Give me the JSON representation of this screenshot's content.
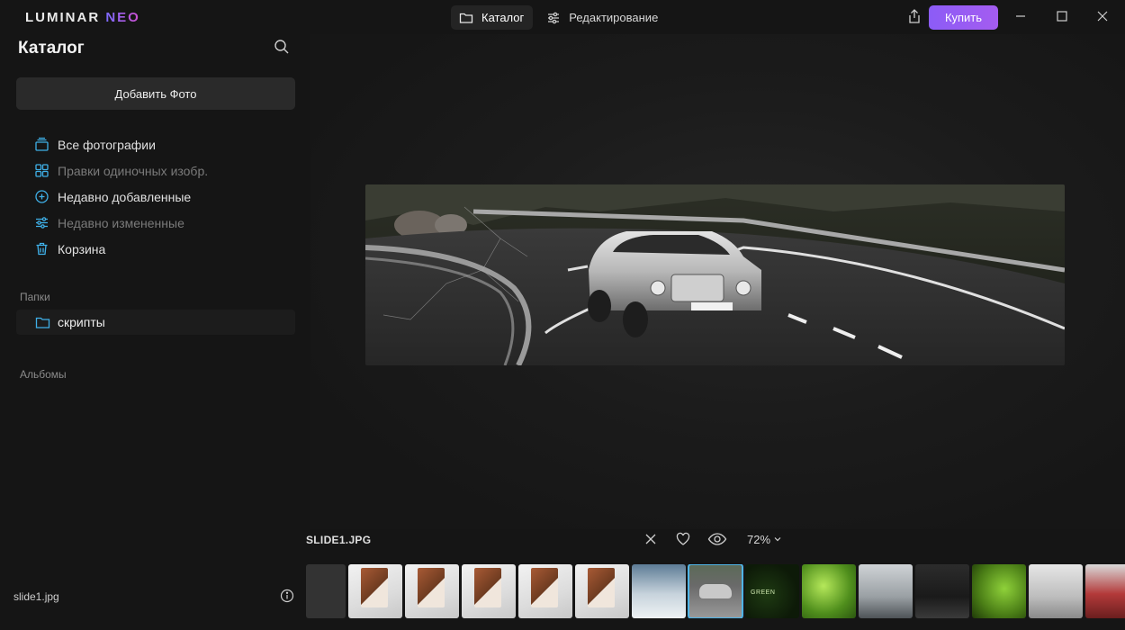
{
  "app": {
    "logo_main": "LUMINAR",
    "logo_accent": "NEO"
  },
  "modes": [
    {
      "label": "Каталог",
      "icon": "folder-icon",
      "active": true
    },
    {
      "label": "Редактирование",
      "icon": "sliders-icon",
      "active": false
    }
  ],
  "titlebar": {
    "buy_label": "Купить",
    "buy_color": "#8c5cf6"
  },
  "sidebar": {
    "title": "Каталог",
    "add_photo_label": "Добавить Фото",
    "nav": [
      {
        "label": "Все фотографии",
        "icon": "stack-icon",
        "dim": false
      },
      {
        "label": "Правки одиночных изобр.",
        "icon": "grid-icon",
        "dim": true
      },
      {
        "label": "Недавно добавленные",
        "icon": "plus-circle-icon",
        "dim": false
      },
      {
        "label": "Недавно измененные",
        "icon": "sliders-icon",
        "dim": true
      },
      {
        "label": "Корзина",
        "icon": "trash-icon",
        "dim": false
      }
    ],
    "folders_label": "Папки",
    "folders": [
      {
        "label": "скрипты",
        "icon": "folder-icon"
      }
    ],
    "albums_label": "Альбомы",
    "current_file": "slide1.jpg"
  },
  "viewer": {
    "filename": "SLIDE1.JPG",
    "zoom": "72%",
    "accent_color": "#4fb4e6"
  },
  "filmstrip": {
    "thumbs": [
      {
        "kind": "t-first",
        "selected": false,
        "text": ""
      },
      {
        "kind": "t-box",
        "selected": false,
        "text": ""
      },
      {
        "kind": "t-box",
        "selected": false,
        "text": ""
      },
      {
        "kind": "t-box",
        "selected": false,
        "text": ""
      },
      {
        "kind": "t-box",
        "selected": false,
        "text": ""
      },
      {
        "kind": "t-box",
        "selected": false,
        "text": ""
      },
      {
        "kind": "t-snow",
        "selected": false,
        "text": ""
      },
      {
        "kind": "t-car",
        "selected": true,
        "text": ""
      },
      {
        "kind": "t-green1",
        "selected": false,
        "text": "GREEN"
      },
      {
        "kind": "t-green2",
        "selected": false,
        "text": ""
      },
      {
        "kind": "t-alfa",
        "selected": false,
        "text": ""
      },
      {
        "kind": "t-dark",
        "selected": false,
        "text": ""
      },
      {
        "kind": "t-green3",
        "selected": false,
        "text": ""
      },
      {
        "kind": "t-silver",
        "selected": false,
        "text": ""
      },
      {
        "kind": "t-red",
        "selected": false,
        "text": ""
      }
    ]
  }
}
